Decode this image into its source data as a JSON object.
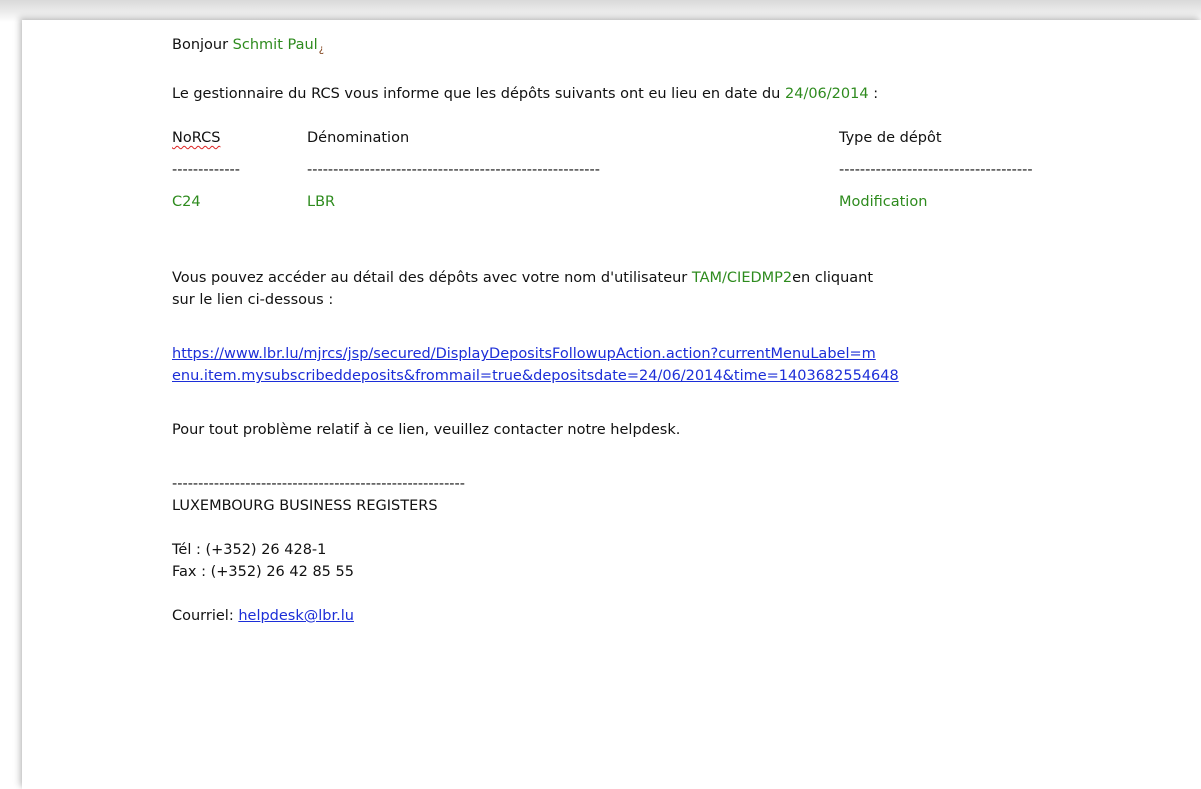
{
  "greeting": {
    "prefix": "Bonjour",
    "name": "Schmit Paul",
    "mark": "¿"
  },
  "intro": {
    "text": "Le gestionnaire du RCS vous informe que les dépôts suivants ont eu lieu en date du",
    "date": "24/06/2014",
    "suffix": ":"
  },
  "table": {
    "headers": [
      "NoRCS",
      "Dénomination",
      "Type de dépôt"
    ],
    "separators": [
      "-------------",
      "--------------------------------------------------------",
      "-------------------------------------"
    ],
    "rows": [
      [
        "C24",
        "LBR",
        "Modification"
      ]
    ]
  },
  "access": {
    "line1_prefix": "Vous pouvez accéder au détail des dépôts avec votre nom d'utilisateur",
    "username": "TAM/CIEDMP2",
    "line1_suffix": "en cliquant",
    "line2": "sur le lien ci-dessous :"
  },
  "link": {
    "line1": "https://www.lbr.lu/mjrcs/jsp/secured/DisplayDepositsFollowupAction.action?currentMenuLabel=m",
    "line2": "enu.item.mysubscribeddeposits&frommail=true&depositsdate=24/06/2014&time=1403682554648"
  },
  "help": "Pour tout problème relatif à ce lien, veuillez contacter notre helpdesk.",
  "signature": {
    "separator": "--------------------------------------------------------",
    "org": "LUXEMBOURG BUSINESS REGISTERS",
    "tel": "Tél : (+352) 26 428-1",
    "fax": "Fax : (+352) 26 42 85 55",
    "email_label": "Courriel:",
    "email": "helpdesk@lbr.lu"
  }
}
